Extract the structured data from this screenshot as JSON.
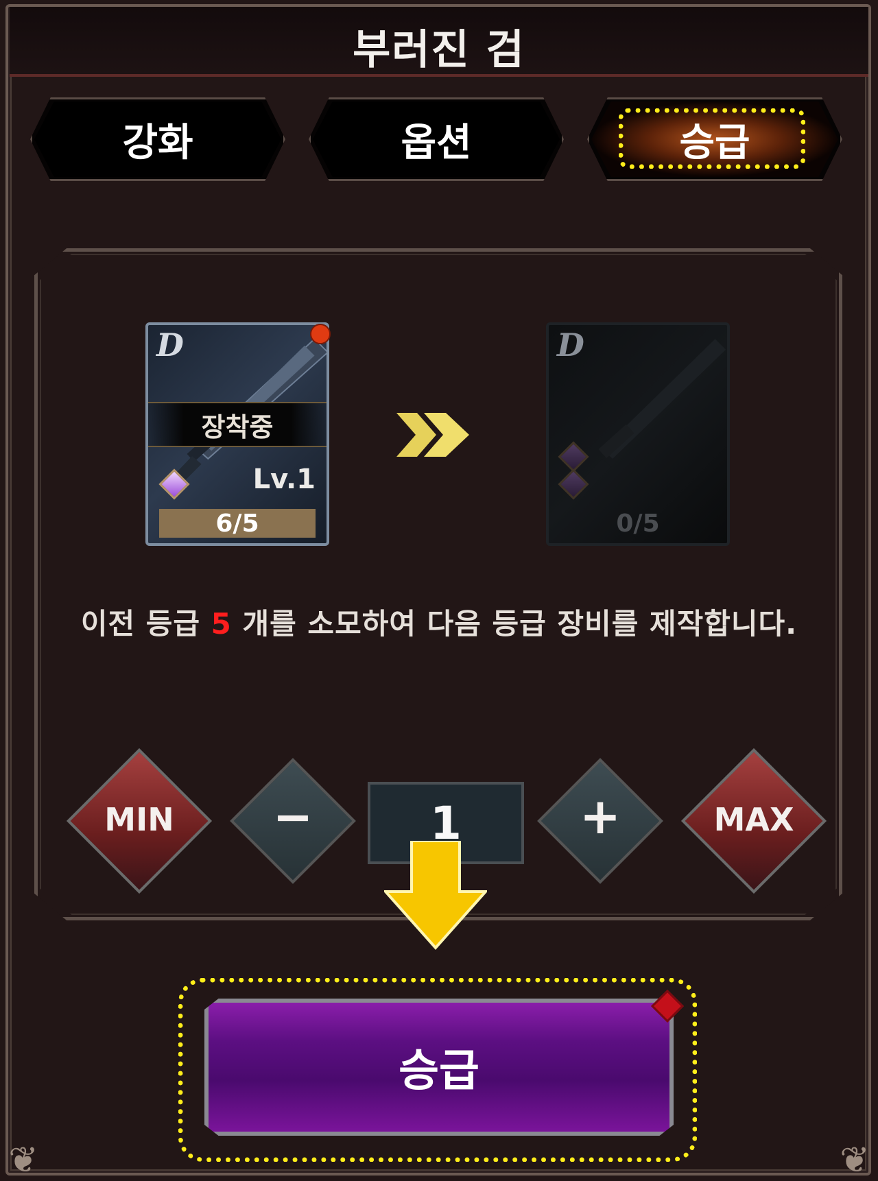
{
  "header": {
    "title": "부러진 검"
  },
  "tabs": [
    {
      "label": "강화",
      "active": false
    },
    {
      "label": "옵션",
      "active": false
    },
    {
      "label": "승급",
      "active": true
    }
  ],
  "current_item": {
    "grade": "D",
    "equipped_label": "장착중",
    "level": "Lv.1",
    "count": "6/5"
  },
  "next_item": {
    "grade": "D",
    "count": "0/5"
  },
  "description": {
    "before": "이전 등급 ",
    "amount": "5",
    "after": " 개를 소모하여 다음 등급 장비를 제작합니다."
  },
  "quantity": {
    "min_label": "MIN",
    "minus_label": "−",
    "value": "1",
    "plus_label": "+",
    "max_label": "MAX"
  },
  "action": {
    "promote_label": "승급"
  },
  "colors": {
    "highlight": "#ffee1a",
    "accent_purple": "#6a0f8e",
    "arrow_yellow": "#f7c600",
    "notice_red": "#ff1e1e"
  }
}
